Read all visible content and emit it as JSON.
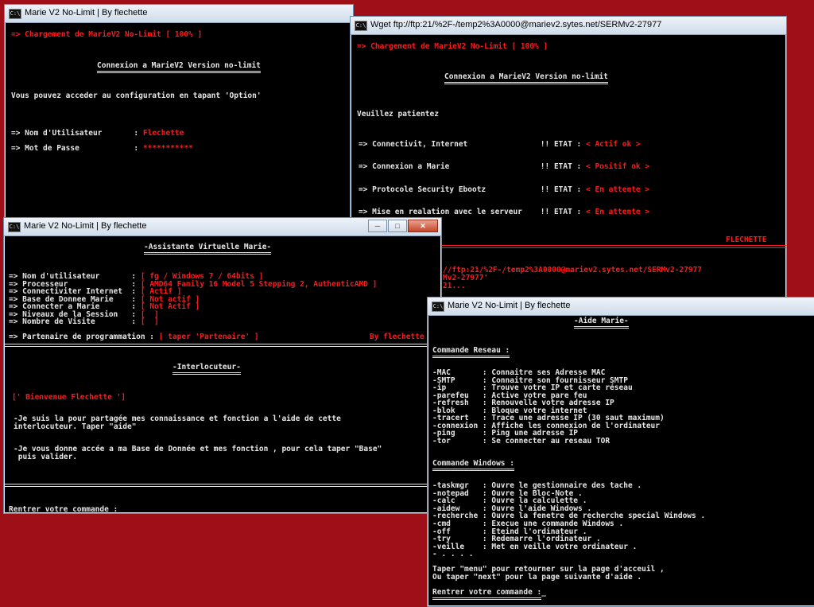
{
  "colors": {
    "desktop": "#9e0f17",
    "console_bg": "#000000",
    "text": "#e6e6e6",
    "accent": "#ff1a1a"
  },
  "win1": {
    "title": "Marie V2 No-Limit  | By flechette",
    "loading": "=> Chargement de MarieV2 No-Limit [ 100% ]",
    "heading": "Connexion a MarieV2 Version no-limit",
    "info": "Vous pouvez acceder au configuration en tapant 'Option'",
    "user_label": "=> Nom d'Utilisateur       :",
    "user_value": "Flechette",
    "pass_label": "=> Mot de Passe            :",
    "pass_value": "***********"
  },
  "win2": {
    "title": "Wget ftp://ftp:21/%2F-/temp2%3A0000@mariev2.sytes.net/SERMv2-27977",
    "loading": "=> Chargement de MarieV2 No-Limit [ 100% ]",
    "heading": "Connexion a MarieV2 Version no-limit",
    "wait": "Veuillez patientez",
    "status": [
      {
        "label": "=> Connectivit, Internet                !! ETAT :",
        "value": "< Actif ok >"
      },
      {
        "label": "=> Connexion a Marie                    !! ETAT :",
        "value": "< Positif ok >"
      },
      {
        "label": "=> Protocole Security Ebootz            !! ETAT :",
        "value": "< En attente >"
      },
      {
        "label": "=> Mise en realation avec le serveur    !! ETAT :",
        "value": "< En attente >"
      }
    ],
    "signature": "FLECHETTE",
    "wget_line1": "//ftp:21/%2F-/temp2%3A0000@mariev2.sytes.net/SERMv2-27977",
    "wget_line2": "Mv2-27977'",
    "wget_line3": "21..."
  },
  "win3": {
    "title": "Marie V2 No-Limit  | By flechette",
    "heading": "-Assistante Virtuelle Marie-",
    "info": [
      {
        "label": "=> Nom d'utilisateur       :",
        "value": "[ fg / Windows 7 / 64bits ]"
      },
      {
        "label": "=> Processeur              :",
        "value": "[ AMD64 Family 16 Model 5 Stepping 2, AuthenticAMD ]"
      },
      {
        "label": "=> Connectiviter Internet  :",
        "value": "[ Actif ]"
      },
      {
        "label": "=> Base de Donnee Marie    :",
        "value": "[ Not actif ]"
      },
      {
        "label": "=> Connecter a Marie       :",
        "value": "[ Not Actif ]"
      },
      {
        "label": "=> Niveaux de la Session   :",
        "value": "[  ]"
      },
      {
        "label": "=> Nombre de Visite        :",
        "value": "[  ]"
      }
    ],
    "partner_label": "=> Partenaire de programmation :",
    "partner_value": "[ taper 'Partenaire' ]",
    "by": "By flechette",
    "interlocuteur": "-Interlocuteur-",
    "welcome": "[' Bienvenue Flechette ']",
    "msg1": "-Je suis la pour partagée mes connaissance et fonction a l'aide de cette\ninterlocuteur. Taper \"aide\"",
    "msg2": "-Je vous donne accée a ma Base de Donnée et mes fonction , pour cela taper \"Base\"\n puis valider.",
    "prompt": "Rentrer votre commande :"
  },
  "win4": {
    "title": "Marie V2 No-Limit  | By flechette",
    "heading": "-Aide Marie-",
    "section_network": "Commande Reseau :",
    "network_cmds": [
      "-MAC       : Connaitre ses Adresse MAC",
      "-SMTP      : Connaitre son fournisseur SMTP",
      "-ip        : Trouve votre IP et carte réseau",
      "-parefeu   : Active votre pare feu",
      "-refresh   : Renouvelle votre adresse IP",
      "-blok      : Bloque votre internet",
      "-tracert   : Trace une adresse IP (30 saut maximum)",
      "-connexion : Affiche les connexion de l'ordinateur",
      "-ping      : Ping une adresse IP",
      "-tor       : Se connecter au reseau TOR"
    ],
    "section_windows": "Commande Windows :",
    "windows_cmds": [
      "-taskmgr   : Ouvre le gestionnaire des tache .",
      "-notepad   : Ouvre le Bloc-Note .",
      "-calc      : Ouvre la calculette .",
      "-aidew     : Ouvre l'aide Windows .",
      "-recherche : Ouvre la fenetre de recherche special Windows .",
      "-cmd       : Execue une commande Windows .",
      "-off       : Eteind l'ordinateur .",
      "-try       : Redemarre l'ordinateur .",
      "-veille    : Met en veille votre ordinateur .",
      "- . . . ."
    ],
    "menu_hint1": "Taper \"menu\" pour retourner sur la page d'acceuil ,",
    "menu_hint2": "Ou taper \"next\" pour la page suivante d'aide .",
    "prompt": "Rentrer votre commande :"
  }
}
